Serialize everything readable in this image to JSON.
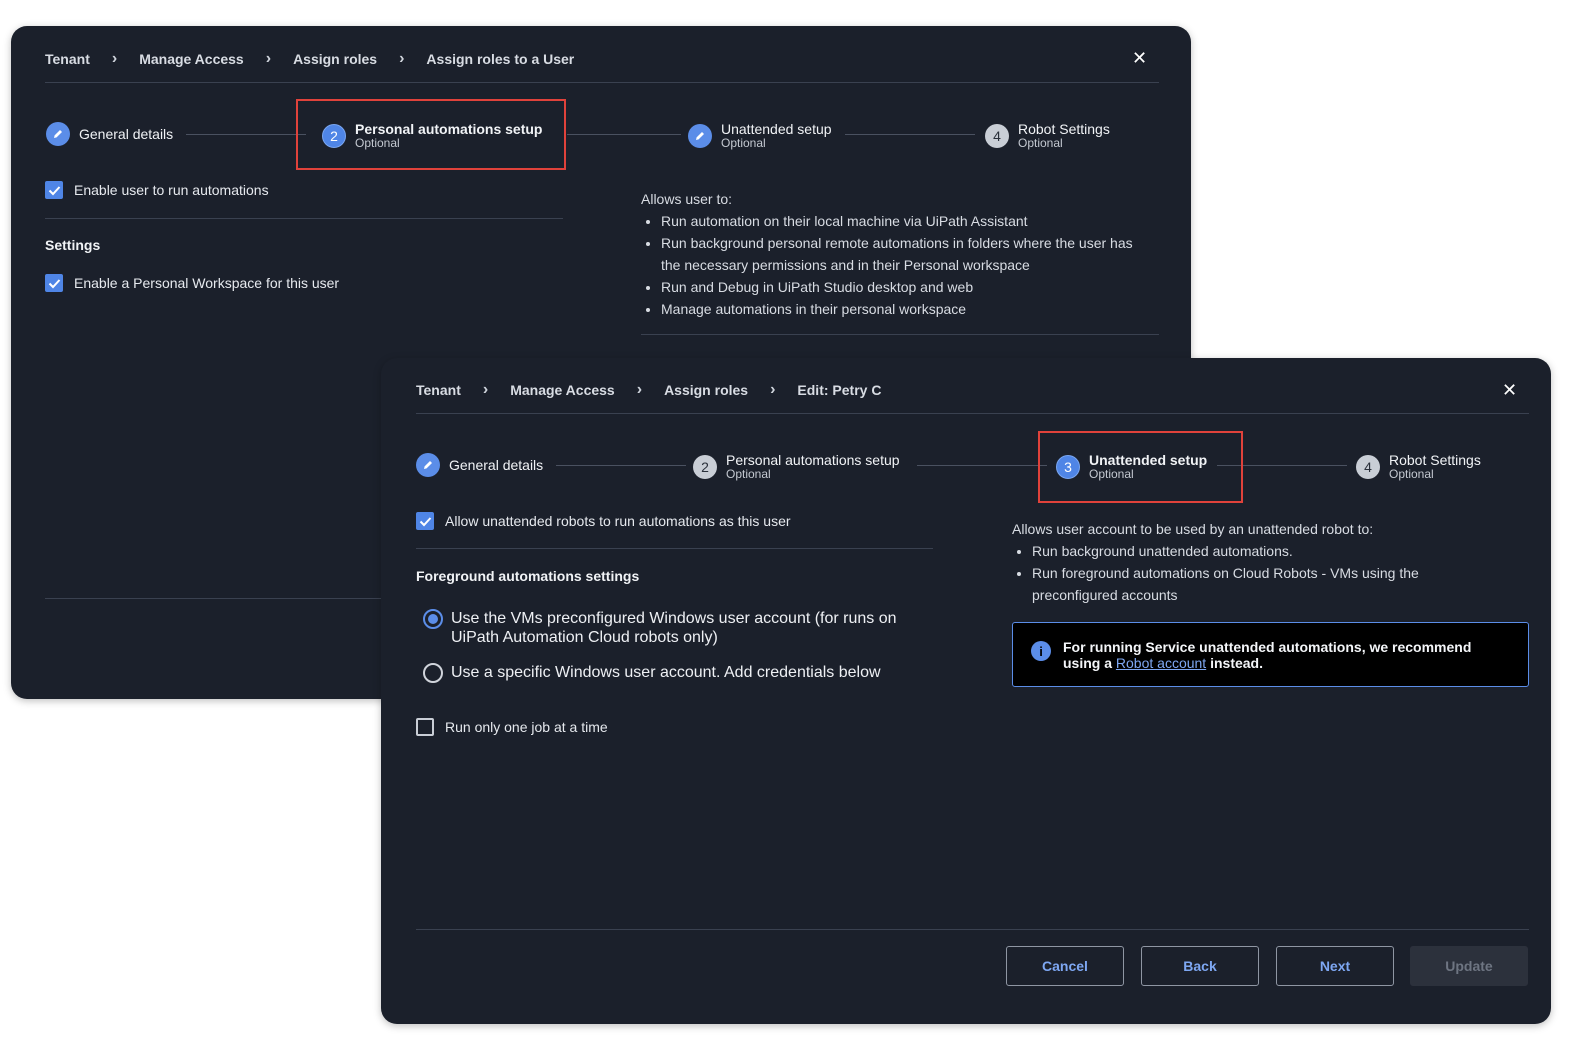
{
  "back_dialog": {
    "breadcrumb": [
      "Tenant",
      "Manage Access",
      "Assign roles",
      "Assign roles to a User"
    ],
    "steps": [
      {
        "title": "General details",
        "subtitle": "",
        "number": "",
        "state": "done"
      },
      {
        "title": "Personal automations setup",
        "subtitle": "Optional",
        "number": "2",
        "state": "active"
      },
      {
        "title": "Unattended setup",
        "subtitle": "Optional",
        "number": "",
        "state": "done"
      },
      {
        "title": "Robot Settings",
        "subtitle": "Optional",
        "number": "4",
        "state": "todo"
      }
    ],
    "enable_automations_label": "Enable user to run automations",
    "settings_heading": "Settings",
    "personal_workspace_label": "Enable a Personal Workspace for this user",
    "allows_intro": "Allows user to:",
    "allows_items": [
      "Run automation on their local machine via UiPath Assistant",
      "Run background personal remote automations in folders where the user has the necessary permissions and in their Personal workspace",
      "Run and Debug in UiPath Studio desktop and web",
      "Manage automations in their personal workspace"
    ]
  },
  "front_dialog": {
    "breadcrumb": [
      "Tenant",
      "Manage Access",
      "Assign roles",
      "Edit: Petry C"
    ],
    "steps": [
      {
        "title": "General details",
        "subtitle": "",
        "number": "",
        "state": "done"
      },
      {
        "title": "Personal automations setup",
        "subtitle": "Optional",
        "number": "2",
        "state": "todo"
      },
      {
        "title": "Unattended setup",
        "subtitle": "Optional",
        "number": "3",
        "state": "active"
      },
      {
        "title": "Robot Settings",
        "subtitle": "Optional",
        "number": "4",
        "state": "todo"
      }
    ],
    "allow_unattended_label": "Allow unattended robots to run automations as this user",
    "foreground_heading": "Foreground automations settings",
    "radio_options": [
      {
        "label": "Use the VMs preconfigured Windows user account (for runs on UiPath Automation Cloud robots only)",
        "selected": true
      },
      {
        "label": "Use a specific Windows user account. Add credentials below",
        "selected": false
      }
    ],
    "one_job_label": "Run only one job at a time",
    "allows_intro": "Allows user account to be used by an unattended robot to:",
    "allows_items": [
      "Run background unattended automations.",
      "Run foreground automations on Cloud Robots - VMs using the preconfigured accounts"
    ],
    "notice_text_before": "For running Service unattended automations, we recommend using a",
    "notice_link": "Robot account",
    "notice_text_after": "instead.",
    "buttons": {
      "cancel": "Cancel",
      "back": "Back",
      "next": "Next",
      "update": "Update"
    }
  },
  "icons": {
    "close": "close-icon",
    "edit": "pencil-icon",
    "info": "info-icon",
    "chevron": "chevron-right-icon",
    "check": "check-icon"
  },
  "colors": {
    "accent": "#5b8de8",
    "panel": "#1b202b",
    "highlight": "#e0423b"
  }
}
